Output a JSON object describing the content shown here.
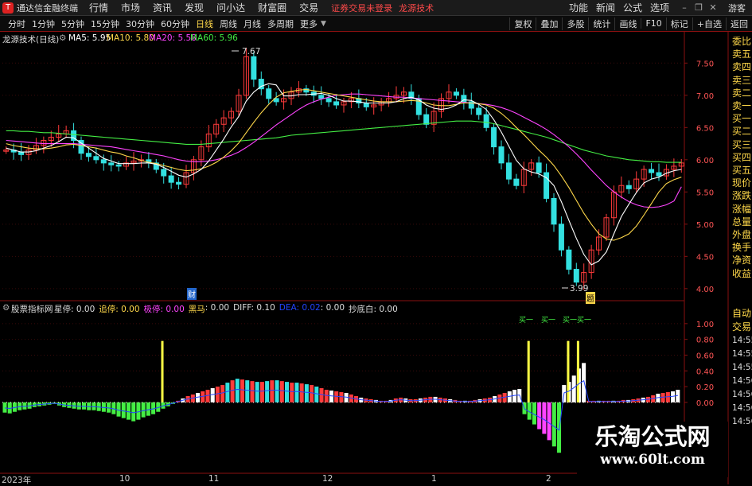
{
  "app": {
    "title": "通达信金融终端"
  },
  "menu": [
    "行情",
    "市场",
    "资讯",
    "发现",
    "问小达",
    "财富圈",
    "交易"
  ],
  "warning": "证券交易未登录",
  "brand": "龙源技术",
  "right_menu": [
    "功能",
    "新闻",
    "公式",
    "选项"
  ],
  "window_controls": [
    "–",
    "❐",
    "✕"
  ],
  "guest": "游客",
  "periods": [
    "分时",
    "1分钟",
    "5分钟",
    "15分钟",
    "30分钟",
    "60分钟",
    "日线",
    "周线",
    "月线",
    "多周期",
    "更多"
  ],
  "active_period": "日线",
  "toolbar_right": [
    "复权",
    "叠加",
    "多股",
    "统计",
    "画线",
    "F10",
    "标记",
    "+自选",
    "返回"
  ],
  "main_chart": {
    "title": "龙源技术(日线)",
    "ma": [
      {
        "label": "MA5: 5.95",
        "color": "#ffffff"
      },
      {
        "label": "MA10: 5.80",
        "color": "#ffd84a"
      },
      {
        "label": "MA20: 5.58",
        "color": "#ff44ff"
      },
      {
        "label": "MA60: 5.96",
        "color": "#44ee44"
      }
    ],
    "high_label": "7.67",
    "low_label": "3.99",
    "marker_cai": "财",
    "marker_ti": "题"
  },
  "chart_data": [
    {
      "type": "line",
      "ylim": [
        3.85,
        7.8
      ],
      "yticks": [
        "7.50",
        "7.00",
        "6.50",
        "6.00",
        "5.50",
        "5.00",
        "4.50",
        "4.00"
      ],
      "close": [
        6.15,
        6.12,
        6.08,
        6.15,
        6.22,
        6.3,
        6.35,
        6.4,
        6.45,
        6.3,
        6.1,
        6.05,
        6.0,
        5.95,
        5.92,
        5.9,
        5.95,
        5.98,
        6.0,
        5.95,
        5.85,
        5.75,
        5.65,
        5.62,
        5.8,
        6.0,
        6.2,
        6.4,
        6.55,
        6.65,
        6.75,
        7.0,
        7.6,
        7.25,
        7.1,
        6.95,
        6.9,
        6.95,
        7.05,
        7.1,
        7.05,
        7.0,
        6.95,
        6.9,
        6.85,
        6.9,
        6.95,
        6.88,
        6.82,
        6.85,
        6.9,
        6.95,
        7.0,
        7.05,
        6.95,
        6.7,
        6.55,
        6.75,
        6.95,
        7.05,
        7.0,
        6.9,
        6.8,
        6.7,
        6.5,
        6.2,
        5.95,
        5.7,
        5.6,
        5.85,
        5.95,
        5.8,
        5.4,
        5.0,
        4.6,
        4.3,
        4.1,
        4.25,
        4.6,
        4.8,
        5.1,
        5.5,
        5.6,
        5.55,
        5.7,
        5.85,
        5.8,
        5.75,
        5.85,
        5.9,
        5.95
      ],
      "ma5": [
        6.18,
        6.15,
        6.12,
        6.12,
        6.14,
        6.18,
        6.22,
        6.28,
        6.35,
        6.34,
        6.26,
        6.18,
        6.1,
        6.02,
        5.98,
        5.94,
        5.94,
        5.94,
        5.95,
        5.95,
        5.93,
        5.88,
        5.82,
        5.76,
        5.73,
        5.78,
        5.85,
        5.98,
        6.15,
        6.32,
        6.51,
        6.67,
        6.91,
        7.05,
        7.14,
        7.18,
        7.16,
        6.99,
        6.99,
        7.01,
        7.01,
        7.02,
        7.03,
        7.0,
        6.95,
        6.91,
        6.91,
        6.9,
        6.88,
        6.88,
        6.88,
        6.88,
        6.9,
        6.95,
        6.97,
        6.93,
        6.85,
        6.8,
        6.78,
        6.8,
        6.85,
        6.93,
        6.92,
        6.86,
        6.78,
        6.62,
        6.43,
        6.21,
        5.99,
        5.86,
        5.81,
        5.78,
        5.72,
        5.6,
        5.35,
        5.06,
        4.78,
        4.53,
        4.37,
        4.43,
        4.57,
        4.85,
        5.12,
        5.31,
        5.49,
        5.64,
        5.7,
        5.73,
        5.79,
        5.83,
        5.85
      ],
      "ma10": [
        6.25,
        6.22,
        6.2,
        6.18,
        6.17,
        6.17,
        6.18,
        6.2,
        6.23,
        6.24,
        6.22,
        6.2,
        6.18,
        6.15,
        6.12,
        6.1,
        6.06,
        6.03,
        5.99,
        5.96,
        5.94,
        5.91,
        5.88,
        5.85,
        5.83,
        5.84,
        5.86,
        5.9,
        5.96,
        6.04,
        6.14,
        6.26,
        6.42,
        6.58,
        6.73,
        6.86,
        6.97,
        7.04,
        7.06,
        7.08,
        7.09,
        7.07,
        7.05,
        7.03,
        7.01,
        6.99,
        6.97,
        6.95,
        6.93,
        6.91,
        6.9,
        6.9,
        6.9,
        6.91,
        6.92,
        6.91,
        6.88,
        6.85,
        6.84,
        6.84,
        6.86,
        6.88,
        6.88,
        6.87,
        6.85,
        6.8,
        6.72,
        6.62,
        6.5,
        6.39,
        6.27,
        6.15,
        6.04,
        5.91,
        5.75,
        5.57,
        5.37,
        5.17,
        5.0,
        4.85,
        4.77,
        4.75,
        4.79,
        4.85,
        4.97,
        5.14,
        5.32,
        5.5,
        5.63,
        5.69,
        5.73
      ],
      "ma20": [
        6.3,
        6.29,
        6.28,
        6.27,
        6.26,
        6.25,
        6.25,
        6.25,
        6.25,
        6.25,
        6.24,
        6.23,
        6.22,
        6.21,
        6.2,
        6.18,
        6.16,
        6.14,
        6.12,
        6.1,
        6.08,
        6.06,
        6.03,
        6.0,
        5.98,
        5.97,
        5.97,
        5.98,
        6.0,
        6.03,
        6.07,
        6.12,
        6.19,
        6.27,
        6.36,
        6.45,
        6.54,
        6.62,
        6.7,
        6.78,
        6.85,
        6.9,
        6.94,
        6.97,
        7.0,
        7.01,
        7.02,
        7.02,
        7.01,
        7.0,
        6.99,
        6.98,
        6.97,
        6.97,
        6.96,
        6.95,
        6.94,
        6.93,
        6.92,
        6.91,
        6.9,
        6.89,
        6.88,
        6.87,
        6.86,
        6.84,
        6.81,
        6.77,
        6.72,
        6.66,
        6.6,
        6.54,
        6.47,
        6.39,
        6.3,
        6.2,
        6.09,
        5.97,
        5.84,
        5.72,
        5.6,
        5.5,
        5.42,
        5.35,
        5.3,
        5.27,
        5.26,
        5.27,
        5.3,
        5.36,
        5.58
      ],
      "ma60": [
        6.45,
        6.45,
        6.44,
        6.44,
        6.43,
        6.42,
        6.42,
        6.41,
        6.4,
        6.39,
        6.38,
        6.37,
        6.36,
        6.35,
        6.34,
        6.33,
        6.32,
        6.31,
        6.3,
        6.29,
        6.28,
        6.27,
        6.26,
        6.25,
        6.24,
        6.24,
        6.24,
        6.25,
        6.26,
        6.27,
        6.28,
        6.29,
        6.3,
        6.31,
        6.32,
        6.33,
        6.34,
        6.36,
        6.38,
        6.39,
        6.4,
        6.41,
        6.42,
        6.43,
        6.44,
        6.45,
        6.46,
        6.47,
        6.48,
        6.49,
        6.5,
        6.51,
        6.52,
        6.53,
        6.54,
        6.55,
        6.56,
        6.57,
        6.58,
        6.59,
        6.6,
        6.6,
        6.6,
        6.59,
        6.58,
        6.56,
        6.53,
        6.5,
        6.47,
        6.44,
        6.41,
        6.38,
        6.35,
        6.31,
        6.27,
        6.23,
        6.19,
        6.15,
        6.12,
        6.09,
        6.06,
        6.04,
        6.02,
        6.0,
        5.99,
        5.98,
        5.97,
        5.97,
        5.96,
        5.96,
        5.96
      ]
    },
    {
      "type": "bar",
      "ylim": [
        -0.85,
        1.15
      ],
      "yticks": [
        "1.00",
        "0.80",
        "0.60",
        "0.40",
        "0.20",
        "0.00"
      ],
      "values": [
        -0.13,
        -0.14,
        -0.12,
        -0.1,
        -0.09,
        -0.08,
        -0.06,
        -0.05,
        -0.04,
        -0.03,
        -0.02,
        -0.04,
        -0.06,
        -0.07,
        -0.08,
        -0.09,
        -0.09,
        -0.1,
        -0.1,
        -0.11,
        -0.12,
        -0.13,
        -0.15,
        -0.18,
        -0.2,
        -0.22,
        -0.24,
        -0.22,
        -0.19,
        -0.17,
        -0.15,
        -0.12,
        -0.08,
        -0.05,
        -0.02,
        0.02,
        0.05,
        0.08,
        0.1,
        0.12,
        0.14,
        0.16,
        0.18,
        0.2,
        0.22,
        0.25,
        0.28,
        0.3,
        0.29,
        0.28,
        0.27,
        0.26,
        0.26,
        0.27,
        0.28,
        0.28,
        0.27,
        0.26,
        0.25,
        0.25,
        0.24,
        0.23,
        0.22,
        0.2,
        0.18,
        0.16,
        0.15,
        0.14,
        0.13,
        0.12,
        0.1,
        0.08,
        0.06,
        0.05,
        0.04,
        0.03,
        0.02,
        0.02,
        0.03,
        0.05,
        0.06,
        0.05,
        0.04,
        0.04,
        0.05,
        0.06,
        0.07,
        0.07,
        0.06,
        0.05,
        0.04,
        0.03,
        0.02,
        0.02,
        0.02,
        0.03,
        0.04,
        0.05,
        0.06,
        0.08,
        0.1,
        0.12,
        0.14,
        0.16,
        0.17,
        -0.15,
        -0.22,
        -0.28,
        -0.34,
        -0.4,
        -0.48,
        -0.56,
        -0.64,
        0.22,
        0.26,
        0.34,
        0.43,
        0.5,
        0.02,
        0.02,
        0.02,
        0.02,
        0.02,
        0.02,
        0.02,
        0.03,
        0.03,
        0.04,
        0.05,
        0.06,
        0.07,
        0.09,
        0.11,
        0.12,
        0.13,
        0.14,
        0.16
      ],
      "spikes": [
        {
          "index": 32,
          "value": 0.78
        },
        {
          "index": 106,
          "value": 0.78
        },
        {
          "index": 114,
          "value": 0.78
        },
        {
          "index": 116,
          "value": 0.78
        }
      ]
    }
  ],
  "indicator": {
    "title": "股票指标网",
    "items": [
      {
        "label": "星停: 0.00",
        "color": "#dddddd"
      },
      {
        "label": "追停: 0.00",
        "color": "#ffd84a"
      },
      {
        "label": "极停: 0.00",
        "color": "#ff44ff"
      },
      {
        "label": "黑马",
        "color": "#ffd84a"
      },
      {
        "label": ": 0.00",
        "color": "#dddddd"
      },
      {
        "label": "DIFF: 0.10",
        "color": "#dddddd"
      },
      {
        "label": "DEA: 0.02",
        "color": "#2244ff"
      },
      {
        "label": ": 0.00",
        "color": "#dddddd"
      },
      {
        "label": "抄底白: 0.00",
        "color": "#dddddd"
      }
    ],
    "signals": [
      "买一",
      "买一",
      "买一买一"
    ]
  },
  "side_panel": [
    "委比",
    "卖五",
    "卖四",
    "卖三",
    "卖二",
    "卖一",
    "买一",
    "买二",
    "买三",
    "买四",
    "买五",
    "现价",
    "涨跌",
    "涨幅",
    "总量",
    "外盘",
    "换手",
    "净资",
    "收益"
  ],
  "side_panel_lower": [
    "自动",
    "交易",
    "14:55",
    "14:55",
    "14:55",
    "14:56",
    "14:56",
    "14:56",
    "14:56"
  ],
  "x_axis": [
    "2023年",
    "10",
    "11",
    "12",
    "1",
    "2"
  ],
  "watermark": {
    "title": "乐淘公式网",
    "url": "www.60lt.com"
  }
}
